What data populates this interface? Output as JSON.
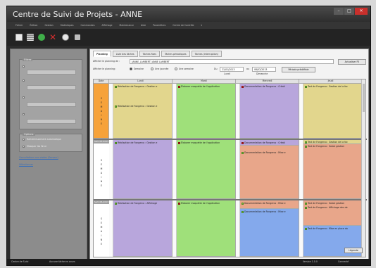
{
  "window": {
    "title": "Centre de Suivi de Projets - ANNE",
    "controls": [
      "–",
      "□",
      "✕"
    ]
  },
  "menu": [
    "Fichier",
    "Édition",
    "Gestion",
    "Statistiques",
    "Commandes",
    "Affichage",
    "Maintenance",
    "Aide",
    "Paramètres",
    "Centre de Contrôle",
    "▾"
  ],
  "toolbar": {
    "icons": [
      "page-icon",
      "list-icon",
      "check-icon",
      "delete-x-icon",
      "globe-icon",
      "settings-icon"
    ],
    "colors": [
      "#e8e8e8",
      "#e8e8e8",
      "#3fae49",
      "#d32f2f",
      "#e8e8e8",
      "#bdbdbd"
    ]
  },
  "left": {
    "group1": "Filtres",
    "group2": "Options",
    "option1": "Rafraîchissement automatique",
    "option2": "Masquer les W-ce",
    "link1": "Consultations non visées (Serveur)",
    "link2": "Sélectionner"
  },
  "tabs": [
    "Planning",
    "Liste des tâches",
    "Tâches fixes",
    "Tâches périodiques",
    "Tâches (interruption)"
  ],
  "filters": {
    "planning_label": "Afficher le planning de :",
    "planning_value": "[ANNE_LAMBERT] ANNE LAMBERT",
    "actualize_btn": "Actualiser F5",
    "show_label": "Afficher le planning :",
    "radio1": "Semaine",
    "radio2": "Une journée",
    "radio3": "Une semaine",
    "from_label": "Du",
    "from_value": "21/01/2013",
    "to_label": "au",
    "to_value": "08/02/2013",
    "period_btn": "Période prédéfinie",
    "sub_from": "Lundi",
    "sub_to": "Dimanche"
  },
  "grid": {
    "headers": [
      "Date",
      "Lundi",
      "Mardi",
      "Mercredi",
      "Jeudi"
    ],
    "weeks": [
      {
        "date": "",
        "letters": [
          "S",
          "E",
          "M",
          "A",
          "I",
          "N",
          "E"
        ]
      },
      {
        "date": "Sem 05-2013",
        "letters": [
          "S",
          "E",
          "M",
          "A",
          "I",
          "N",
          "E"
        ]
      },
      {
        "date": "Sem 06-2013",
        "letters": [
          "S",
          "E",
          "M",
          "A",
          "I",
          "N",
          "E"
        ]
      }
    ],
    "events": {
      "w1_mon_a": "Réalisation de Fongerco : Gestion e",
      "w1_mon_b": "Réalisation de Fongerco : Gestion e",
      "w1_tue": "Élaborer maquette de l'application",
      "w1_wed": "Documentation de Fongerco : Créati",
      "w1_thu": "Test de Fongerco : Gestion de la fac",
      "w2_mon": "Réalisation de Fongerco : Gestion e",
      "w2_tue": "Élaborer maquette de l'application",
      "w2_wed_a": "Documentation de Fongerco : Créati",
      "w2_wed_b": "Documentation de Fongerco : Mise e",
      "w2_thu_a": "Test de Fongerco : Gestion de la fac",
      "w2_thu_b": "Test de Fongerco : Saisie gestion",
      "w3_mon": "Réalisation de Fongerco : Affichage",
      "w3_tue": "Élaborer maquette de l'application",
      "w3_wed_a": "Documentation de Fongerco : Mise e",
      "w3_wed_b": "Documentation de Fongerco : Mise e",
      "w3_thu_a": "Test de Fongerco : Saisie gestion",
      "w3_thu_b": "Test de Fongerco : Affichage des de",
      "w3_thu_c": "Test de Fongerco : Mise en place do"
    },
    "colors": {
      "mon_w1": "#e2d68d",
      "mon": "#b8a6dc",
      "tue": "#9fe07a",
      "wed_w1": "#b8a6dc",
      "wed_w2": "#e8a68a",
      "wed_w3": "#84a9ec",
      "thu_w1": "#e2d68d",
      "thu": "#e8a68a",
      "thu_w3": "#84a9ec",
      "today": "#f6a23a"
    }
  },
  "ok_button": "Légende",
  "status": {
    "left": "Centre de Suivi",
    "middle": "Aucune tâche en cours",
    "right1": "Version 1.0.0",
    "right2": "Connecté"
  }
}
